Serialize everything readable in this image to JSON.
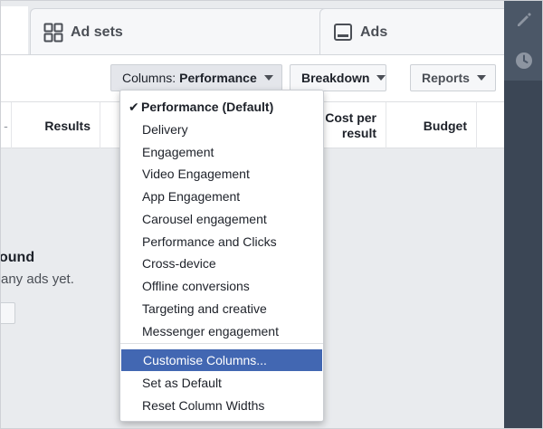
{
  "tabs": {
    "adsets": {
      "label": "Ad sets",
      "icon": "ad-sets-grid-icon"
    },
    "ads": {
      "label": "Ads",
      "icon": "ads-monitor-icon"
    }
  },
  "toolbar": {
    "columns_prefix": "Columns:",
    "columns_value": "Performance",
    "breakdown_label": "Breakdown",
    "reports_label": "Reports"
  },
  "table": {
    "headers": {
      "dash": "-",
      "results": "Results",
      "cost_line1": "Cost per",
      "cost_line2": "result",
      "budget": "Budget"
    }
  },
  "empty_state": {
    "title": "ound",
    "subtitle": "any ads yet."
  },
  "sidebar": {
    "icons": [
      "pencil-icon",
      "clock-icon"
    ]
  },
  "dropdown": {
    "checkmark": "✔",
    "items": [
      "Performance (Default)",
      "Delivery",
      "Engagement",
      "Video Engagement",
      "App Engagement",
      "Carousel engagement",
      "Performance and Clicks",
      "Cross-device",
      "Offline conversions",
      "Targeting and creative",
      "Messenger engagement"
    ],
    "actions": [
      "Customise Columns...",
      "Set as Default",
      "Reset Column Widths"
    ]
  },
  "colors": {
    "highlight": "#4267b2",
    "sidebar": "#3b4655",
    "page_bg": "#e9ebee"
  }
}
